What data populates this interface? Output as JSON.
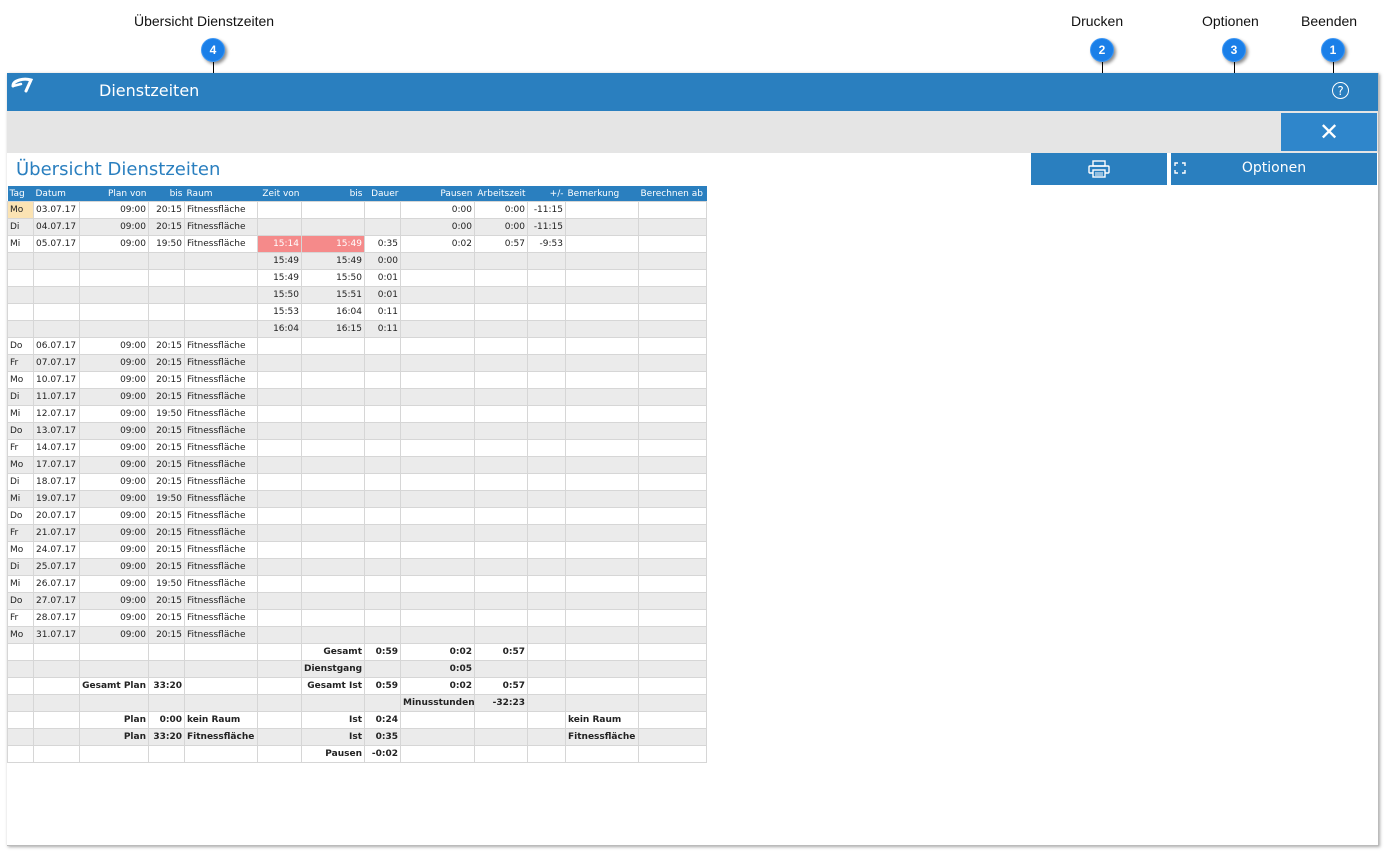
{
  "callouts": [
    {
      "n": "4",
      "label": "Übersicht Dienstzeiten"
    },
    {
      "n": "2",
      "label": "Drucken"
    },
    {
      "n": "3",
      "label": "Optionen"
    },
    {
      "n": "1",
      "label": "Beenden"
    }
  ],
  "window": {
    "title": "Dienstzeiten",
    "help_symbol": "?",
    "close_symbol": "✕",
    "options_label": "Optionen",
    "section_title": "Übersicht Dienstzeiten"
  },
  "colors": {
    "accent": "#2a7fbf",
    "highlight": "#f58a8a",
    "today": "#fbe3b3",
    "badge": "#1a7fe8"
  },
  "table": {
    "headers": [
      "Tag",
      "Datum",
      "Plan von",
      "bis",
      "Raum",
      "Zeit von",
      "bis",
      "Dauer",
      "Pausen",
      "Arbeitszeit",
      "+/-",
      "Bemerkung",
      "Berechnen ab"
    ],
    "rows": [
      [
        "Mo",
        "03.07.17",
        "09:00",
        "20:15",
        "Fitnessfläche",
        "",
        "",
        "",
        "0:00",
        "0:00",
        "-11:15",
        "",
        ""
      ],
      [
        "Di",
        "04.07.17",
        "09:00",
        "20:15",
        "Fitnessfläche",
        "",
        "",
        "",
        "0:00",
        "0:00",
        "-11:15",
        "",
        ""
      ],
      [
        "Mi",
        "05.07.17",
        "09:00",
        "19:50",
        "Fitnessfläche",
        "15:14",
        "15:49",
        "0:35",
        "0:02",
        "0:57",
        "-9:53",
        "",
        ""
      ],
      [
        "",
        "",
        "",
        "",
        "",
        "15:49",
        "15:49",
        "0:00",
        "",
        "",
        "",
        "",
        ""
      ],
      [
        "",
        "",
        "",
        "",
        "",
        "15:49",
        "15:50",
        "0:01",
        "",
        "",
        "",
        "",
        ""
      ],
      [
        "",
        "",
        "",
        "",
        "",
        "15:50",
        "15:51",
        "0:01",
        "",
        "",
        "",
        "",
        ""
      ],
      [
        "",
        "",
        "",
        "",
        "",
        "15:53",
        "16:04",
        "0:11",
        "",
        "",
        "",
        "",
        ""
      ],
      [
        "",
        "",
        "",
        "",
        "",
        "16:04",
        "16:15",
        "0:11",
        "",
        "",
        "",
        "",
        ""
      ],
      [
        "Do",
        "06.07.17",
        "09:00",
        "20:15",
        "Fitnessfläche",
        "",
        "",
        "",
        "",
        "",
        "",
        "",
        ""
      ],
      [
        "Fr",
        "07.07.17",
        "09:00",
        "20:15",
        "Fitnessfläche",
        "",
        "",
        "",
        "",
        "",
        "",
        "",
        ""
      ],
      [
        "Mo",
        "10.07.17",
        "09:00",
        "20:15",
        "Fitnessfläche",
        "",
        "",
        "",
        "",
        "",
        "",
        "",
        ""
      ],
      [
        "Di",
        "11.07.17",
        "09:00",
        "20:15",
        "Fitnessfläche",
        "",
        "",
        "",
        "",
        "",
        "",
        "",
        ""
      ],
      [
        "Mi",
        "12.07.17",
        "09:00",
        "19:50",
        "Fitnessfläche",
        "",
        "",
        "",
        "",
        "",
        "",
        "",
        ""
      ],
      [
        "Do",
        "13.07.17",
        "09:00",
        "20:15",
        "Fitnessfläche",
        "",
        "",
        "",
        "",
        "",
        "",
        "",
        ""
      ],
      [
        "Fr",
        "14.07.17",
        "09:00",
        "20:15",
        "Fitnessfläche",
        "",
        "",
        "",
        "",
        "",
        "",
        "",
        ""
      ],
      [
        "Mo",
        "17.07.17",
        "09:00",
        "20:15",
        "Fitnessfläche",
        "",
        "",
        "",
        "",
        "",
        "",
        "",
        ""
      ],
      [
        "Di",
        "18.07.17",
        "09:00",
        "20:15",
        "Fitnessfläche",
        "",
        "",
        "",
        "",
        "",
        "",
        "",
        ""
      ],
      [
        "Mi",
        "19.07.17",
        "09:00",
        "19:50",
        "Fitnessfläche",
        "",
        "",
        "",
        "",
        "",
        "",
        "",
        ""
      ],
      [
        "Do",
        "20.07.17",
        "09:00",
        "20:15",
        "Fitnessfläche",
        "",
        "",
        "",
        "",
        "",
        "",
        "",
        ""
      ],
      [
        "Fr",
        "21.07.17",
        "09:00",
        "20:15",
        "Fitnessfläche",
        "",
        "",
        "",
        "",
        "",
        "",
        "",
        ""
      ],
      [
        "Mo",
        "24.07.17",
        "09:00",
        "20:15",
        "Fitnessfläche",
        "",
        "",
        "",
        "",
        "",
        "",
        "",
        ""
      ],
      [
        "Di",
        "25.07.17",
        "09:00",
        "20:15",
        "Fitnessfläche",
        "",
        "",
        "",
        "",
        "",
        "",
        "",
        ""
      ],
      [
        "Mi",
        "26.07.17",
        "09:00",
        "19:50",
        "Fitnessfläche",
        "",
        "",
        "",
        "",
        "",
        "",
        "",
        ""
      ],
      [
        "Do",
        "27.07.17",
        "09:00",
        "20:15",
        "Fitnessfläche",
        "",
        "",
        "",
        "",
        "",
        "",
        "",
        ""
      ],
      [
        "Fr",
        "28.07.17",
        "09:00",
        "20:15",
        "Fitnessfläche",
        "",
        "",
        "",
        "",
        "",
        "",
        "",
        ""
      ],
      [
        "Mo",
        "31.07.17",
        "09:00",
        "20:15",
        "Fitnessfläche",
        "",
        "",
        "",
        "",
        "",
        "",
        "",
        ""
      ]
    ],
    "summary_rows": [
      [
        "",
        "",
        "",
        "",
        "",
        "",
        "Gesamt",
        "0:59",
        "0:02",
        "0:57",
        "",
        "",
        ""
      ],
      [
        "",
        "",
        "",
        "",
        "",
        "",
        "Dienstgang",
        "",
        "0:05",
        "",
        "",
        "",
        ""
      ],
      [
        "",
        "",
        "Gesamt Plan",
        "33:20",
        "",
        "",
        "Gesamt Ist",
        "0:59",
        "0:02",
        "0:57",
        "",
        "",
        ""
      ],
      [
        "",
        "",
        "",
        "",
        "",
        "",
        "",
        "",
        "Minusstunden",
        "-32:23",
        "",
        "",
        ""
      ],
      [
        "",
        "",
        "Plan",
        "0:00",
        "kein Raum",
        "",
        "Ist",
        "0:24",
        "",
        "",
        "",
        "kein Raum",
        ""
      ],
      [
        "",
        "",
        "Plan",
        "33:20",
        "Fitnessfläche",
        "",
        "Ist",
        "0:35",
        "",
        "",
        "",
        "Fitnessfläche",
        ""
      ],
      [
        "",
        "",
        "",
        "",
        "",
        "",
        "Pausen",
        "-0:02",
        "",
        "",
        "",
        "",
        ""
      ]
    ]
  }
}
